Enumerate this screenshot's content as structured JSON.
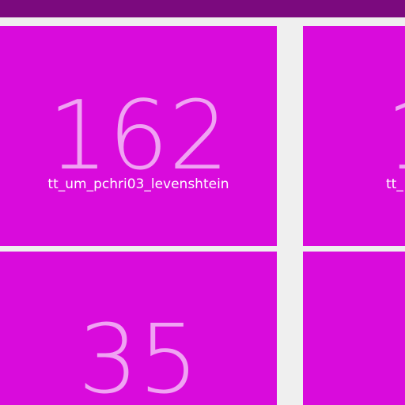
{
  "app": {
    "topbar_color": "#7b0a7e",
    "tile_color": "#d90bdc",
    "number_color": "#f0a3f3",
    "label_color": "#ffffff",
    "background": "#efefef"
  },
  "tiles": [
    {
      "count": "162",
      "label": "tt_um_pchri03_levenshtein"
    },
    {
      "count": "1",
      "label": "tt_"
    },
    {
      "count": "35",
      "label": ""
    },
    {
      "count": "",
      "label": ""
    }
  ]
}
